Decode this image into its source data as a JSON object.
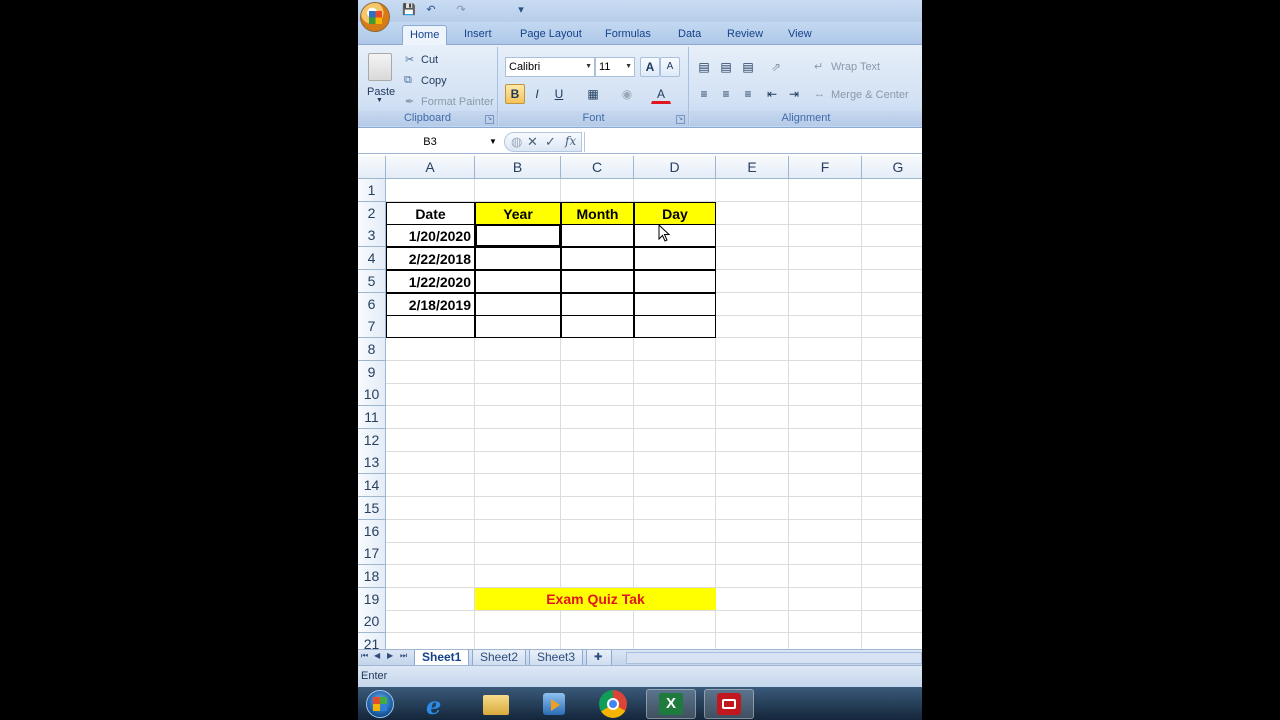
{
  "ribbon": {
    "tabs": [
      "Home",
      "Insert",
      "Page Layout",
      "Formulas",
      "Data",
      "Review",
      "View"
    ],
    "active_tab": "Home",
    "clipboard": {
      "paste": "Paste",
      "cut": "Cut",
      "copy": "Copy",
      "format_painter": "Format Painter",
      "label": "Clipboard"
    },
    "font": {
      "name": "Calibri",
      "size": "11",
      "bold": "B",
      "italic": "I",
      "underline": "U",
      "grow": "A",
      "shrink": "A",
      "color_letter": "A",
      "label": "Font"
    },
    "alignment": {
      "wrap_text": "Wrap Text",
      "merge_center": "Merge & Center",
      "label": "Alignment"
    }
  },
  "formula_bar": {
    "name_box": "B3",
    "fx": "fx",
    "content": ""
  },
  "grid": {
    "columns": [
      "A",
      "B",
      "C",
      "D",
      "E",
      "F",
      "G"
    ],
    "rows": [
      "1",
      "2",
      "3",
      "4",
      "5",
      "6",
      "7",
      "8",
      "9",
      "10",
      "11",
      "12",
      "13",
      "14",
      "15",
      "16",
      "17",
      "18",
      "19",
      "20",
      "21"
    ],
    "headers": {
      "date": "Date",
      "year": "Year",
      "month": "Month",
      "day": "Day"
    },
    "dates": [
      "1/20/2020",
      "2/22/2018",
      "1/22/2020",
      "2/18/2019"
    ],
    "banner": "Exam Quiz Tak",
    "selected_cell": "B3"
  },
  "sheets": [
    "Sheet1",
    "Sheet2",
    "Sheet3"
  ],
  "active_sheet": "Sheet1",
  "status": "Enter",
  "taskbar": [
    "start-orb-icon",
    "internet-explorer-icon",
    "file-explorer-icon",
    "media-player-icon",
    "chrome-icon",
    "excel-icon",
    "screen-recorder-icon"
  ],
  "colors": {
    "highlight": "#ffff00",
    "banner_text": "#e0161e",
    "ribbon_text": "#15428b"
  }
}
